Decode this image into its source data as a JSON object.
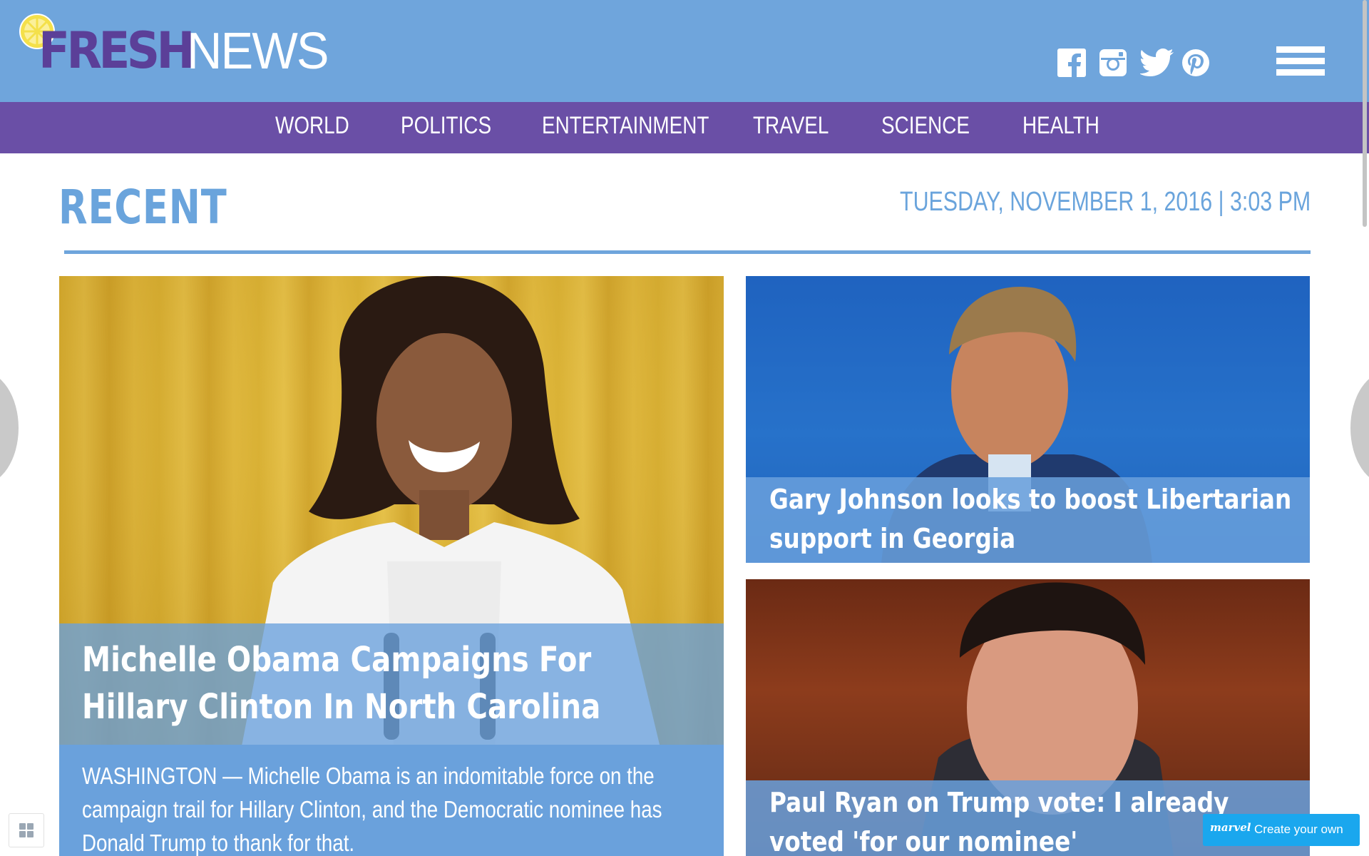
{
  "header": {
    "logo": {
      "fresh": "FRESH",
      "news": "NEWS"
    },
    "social": [
      "facebook-icon",
      "instagram-icon",
      "twitter-icon",
      "pinterest-icon"
    ],
    "menu_icon": "hamburger-menu-icon"
  },
  "nav": {
    "items": [
      "WORLD",
      "POLITICS",
      "ENTERTAINMENT",
      "TRAVEL",
      "SCIENCE",
      "HEALTH"
    ]
  },
  "section": {
    "title": "RECENT",
    "date": "TUESDAY, NOVEMBER 1, 2016",
    "separator": "|",
    "time": "3:03 PM"
  },
  "feature": {
    "headline": "Michelle Obama Campaigns For Hillary Clinton In North Carolina",
    "summary": "WASHINGTON — Michelle Obama is an indomitable force on the campaign trail for Hillary Clinton, and the Democratic nominee has Donald Trump to thank for that."
  },
  "stories": [
    {
      "headline": "Gary Johnson looks to boost Libertarian support in Georgia"
    },
    {
      "headline": "Paul Ryan on Trump vote: I already voted 'for our nominee'"
    }
  ],
  "footer": {
    "grid_icon": "grid-icon",
    "marvel_logo": "marvel",
    "marvel_label": "Create your own"
  },
  "colors": {
    "header_blue": "#6fa5dc",
    "nav_purple": "#6a4fa6",
    "logo_purple": "#5b3f98",
    "accent_blue": "#6aa4dc",
    "marvel_blue": "#1aa7ee"
  }
}
